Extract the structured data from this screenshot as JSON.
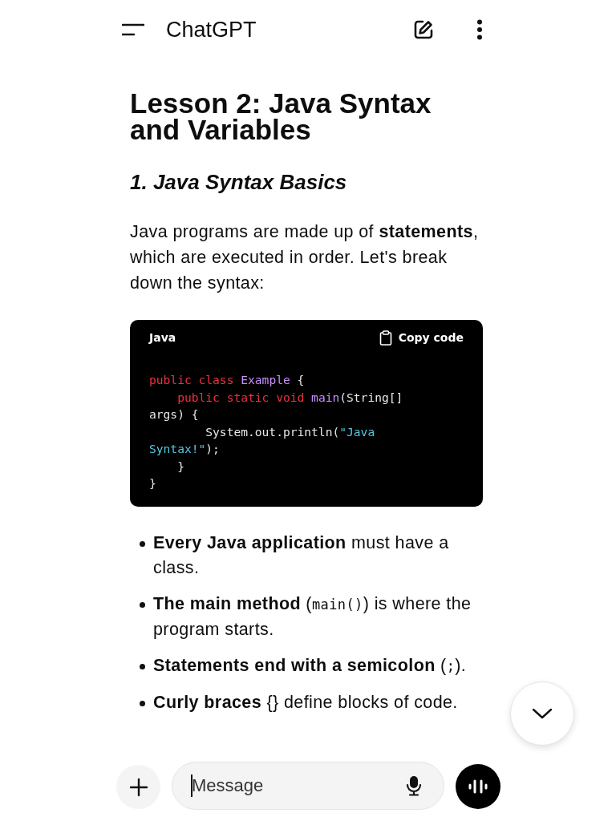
{
  "header": {
    "title": "ChatGPT"
  },
  "heading": "Lesson 2: Java Syntax and Variables",
  "subheading": "1. Java Syntax Basics",
  "intro": "Java programs are made up of **statements**, which are executed in order. Let's break down the syntax:",
  "code_block": {
    "language": "Java",
    "copy_label": "Copy code",
    "lines": [
      [
        {
          "text": "public class ",
          "kind": "keyword"
        },
        {
          "text": "Example",
          "kind": "name"
        },
        {
          "text": " {",
          "kind": "plain"
        }
      ],
      [
        {
          "text": "    public static void ",
          "kind": "keyword"
        },
        {
          "text": "main",
          "kind": "name"
        },
        {
          "text": "(String[]",
          "kind": "plain"
        }
      ],
      [
        {
          "text": "args) {",
          "kind": "plain"
        }
      ],
      [
        {
          "text": "        System.out.println(",
          "kind": "plain"
        },
        {
          "text": "\"Java",
          "kind": "string"
        }
      ],
      [
        {
          "text": "Syntax!\"",
          "kind": "string"
        },
        {
          "text": ");",
          "kind": "plain"
        }
      ],
      [
        {
          "text": "    }",
          "kind": "plain"
        }
      ],
      [
        {
          "text": "}",
          "kind": "plain"
        }
      ]
    ]
  },
  "bullets": [
    [
      {
        "text": "Every Java application",
        "kind": "bold"
      },
      {
        "text": " must have a class.",
        "kind": "plain"
      }
    ],
    [
      {
        "text": "The main method",
        "kind": "bold"
      },
      {
        "text": " (",
        "kind": "plain"
      },
      {
        "text": "main()",
        "kind": "code"
      },
      {
        "text": ") is where the program starts.",
        "kind": "plain"
      }
    ],
    [
      {
        "text": "Statements end with a semicolon",
        "kind": "bold"
      },
      {
        "text": " (",
        "kind": "plain"
      },
      {
        "text": ";",
        "kind": "code"
      },
      {
        "text": ").",
        "kind": "plain"
      }
    ],
    [
      {
        "text": "Curly braces",
        "kind": "bold"
      },
      {
        "text": " {} define blocks of code.",
        "kind": "plain"
      }
    ]
  ],
  "composer": {
    "placeholder": "Message"
  }
}
